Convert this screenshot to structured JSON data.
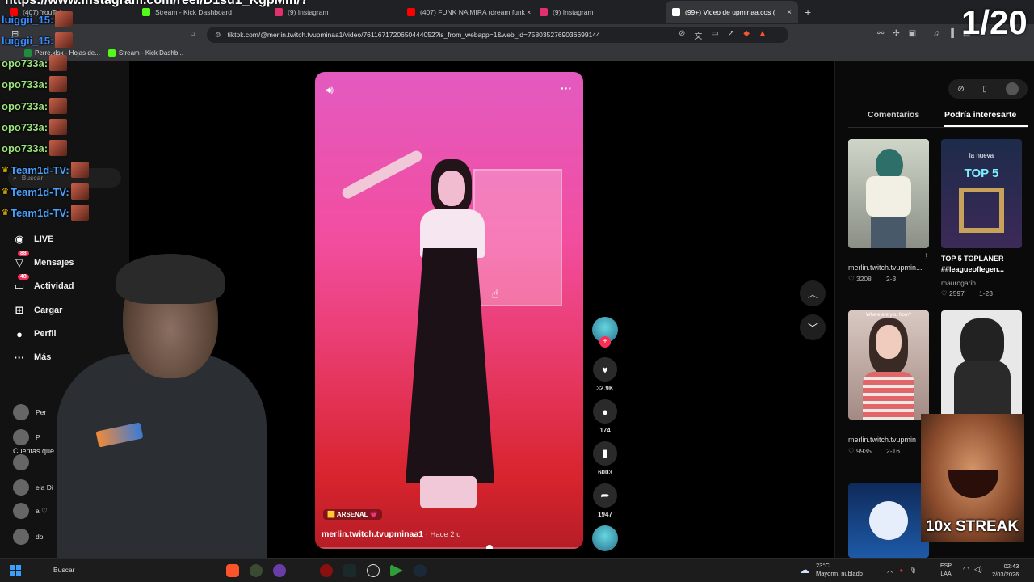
{
  "browser": {
    "tabs": [
      {
        "label": "(407) YouTube",
        "color": "#ff0000",
        "active": false
      },
      {
        "label": "Stream - Kick Dashboard",
        "color": "#53fc18",
        "active": false
      },
      {
        "label": "(9) Instagram",
        "color": "#e1306c",
        "active": false
      },
      {
        "label": "(407) FUNK NA MIRA (dream funk ×",
        "color": "#ff0000",
        "active": false
      },
      {
        "label": "(9) Instagram",
        "color": "#e1306c",
        "active": false
      },
      {
        "label": "(99+) Video de upminaa.cos (",
        "color": "#ffffff",
        "active": true
      }
    ],
    "new_tab": "+",
    "url": "tiktok.com/@merlin.twitch.tvupminaa1/video/7611671720650444052?is_from_webapp=1&web_id=7580352769036699144",
    "bookmarks": [
      {
        "label": "Perre.xlsx - Hojas de...",
        "color": "#1e8e3e"
      },
      {
        "label": "Stream - Kick Dashb...",
        "color": "#53fc18"
      }
    ]
  },
  "overlay": {
    "url_text": "https://www.instagram.com/reel/D1su1_KgpMm/?",
    "counter": "1/20",
    "chat": [
      {
        "user": "luiggii_15:",
        "color": "#3a8cff",
        "crown": false
      },
      {
        "user": "luiggii_15:",
        "color": "#3a8cff",
        "crown": false
      },
      {
        "user": "opo733a:",
        "color": "#9be37a",
        "crown": false
      },
      {
        "user": "opo733a:",
        "color": "#9be37a",
        "crown": false
      },
      {
        "user": "opo733a:",
        "color": "#9be37a",
        "crown": false
      },
      {
        "user": "opo733a:",
        "color": "#9be37a",
        "crown": false
      },
      {
        "user": "opo733a:",
        "color": "#9be37a",
        "crown": false
      },
      {
        "user": "Team1d-TV:",
        "color": "#4aa3ff",
        "crown": true
      },
      {
        "user": "Team1d-TV:",
        "color": "#4aa3ff",
        "crown": true
      },
      {
        "user": "Team1d-TV:",
        "color": "#4aa3ff",
        "crown": true
      }
    ],
    "streak": "10x STREAK"
  },
  "sidebar": {
    "search_placeholder": "Buscar",
    "items": [
      {
        "label": "LIVE",
        "icon": "live-icon",
        "badge": ""
      },
      {
        "label": "Mensajes",
        "icon": "messages-icon",
        "badge": "88"
      },
      {
        "label": "Actividad",
        "icon": "activity-icon",
        "badge": "48"
      },
      {
        "label": "Cargar",
        "icon": "upload-icon",
        "badge": ""
      },
      {
        "label": "Perfil",
        "icon": "profile-icon",
        "badge": ""
      },
      {
        "label": "Más",
        "icon": "more-icon",
        "badge": ""
      }
    ],
    "following_title": "Cuentas que",
    "accounts": [
      "Per",
      "P",
      "",
      "ela Di",
      "a ♡",
      "do"
    ]
  },
  "video": {
    "tag": "🟨 ARSENAL 💗",
    "author": "merlin.twitch.tvupminaa1",
    "ago": " · Hace 2 d",
    "progress": 0.65
  },
  "actions": {
    "likes": "32.9K",
    "comments": "174",
    "saves": "6003",
    "shares": "1947"
  },
  "right_panel": {
    "tabs": [
      "Comentarios",
      "Podría interesarte"
    ],
    "cards": [
      {
        "title": "merlin.twitch.tvupmin...",
        "bold": false,
        "sub": "",
        "likes": "♡ 3208",
        "date": "2-3"
      },
      {
        "title": "TOP 5 TOPLANER ##leagueoflegen...",
        "bold": true,
        "sub": "maurogarih",
        "likes": "♡ 2597",
        "date": "1-23"
      },
      {
        "title": "merlin.twitch.tvupmin",
        "bold": false,
        "sub": "",
        "likes": "♡ 9935",
        "date": "2-16"
      }
    ],
    "thumb_texts": {
      "top5_small": "la nueva",
      "top5_big": "TOP 5",
      "where": "Where are you from?"
    }
  },
  "taskbar": {
    "search": "Buscar",
    "weather_temp": "23°C",
    "weather_desc": "Mayorm. nublado",
    "lang_1": "ESP",
    "lang_2": "LAA",
    "time": "02:43",
    "date": "2/03/2026"
  }
}
